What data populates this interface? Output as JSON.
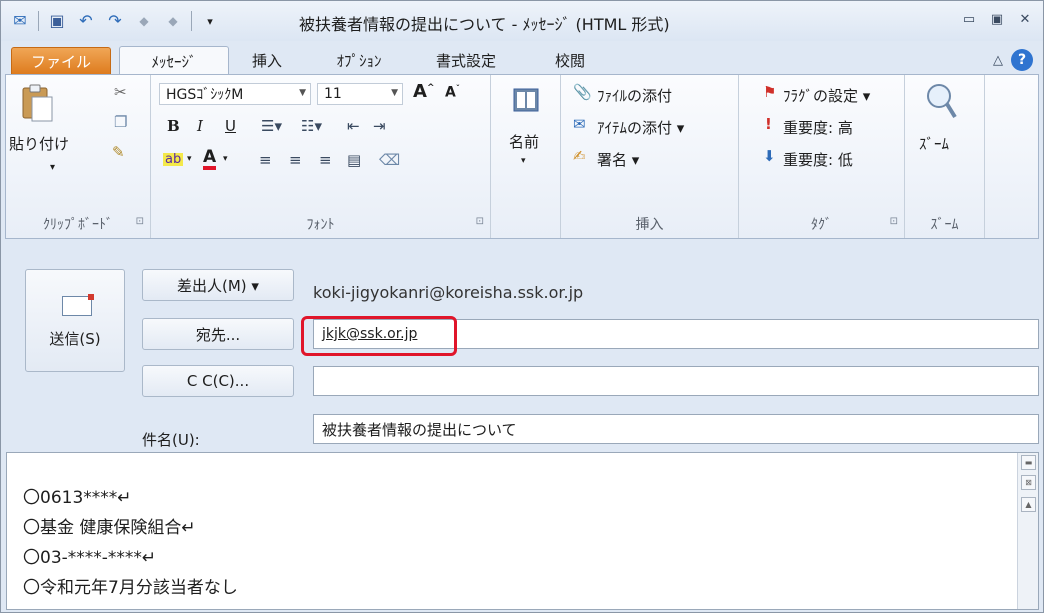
{
  "window": {
    "title": "被扶養者情報の提出について - ﾒｯｾｰｼﾞ (HTML 形式)"
  },
  "tabs": [
    {
      "label": "ファイル"
    },
    {
      "label": "ﾒｯｾｰｼﾞ"
    },
    {
      "label": "挿入"
    },
    {
      "label": "ｵﾌﾟｼｮﾝ"
    },
    {
      "label": "書式設定"
    },
    {
      "label": "校閲"
    }
  ],
  "ribbon": {
    "clipboard": {
      "paste_label": "貼り付け",
      "group_label": "ｸﾘｯﾌﾟﾎﾞｰﾄﾞ"
    },
    "font": {
      "font_name": "HGSｺﾞｼｯｸM",
      "font_size": "11",
      "group_label": "ﾌｫﾝﾄ"
    },
    "names": {
      "label": "名前"
    },
    "insert": {
      "attach_file": "ﾌｧｲﾙの添付",
      "attach_item": "ｱｲﾃﾑの添付 ▾",
      "signature": "署名 ▾",
      "group_label": "挿入"
    },
    "tags": {
      "flag": "ﾌﾗｸﾞの設定 ▾",
      "high": "重要度: 高",
      "low": "重要度: 低",
      "group_label": "ﾀｸﾞ"
    },
    "zoom": {
      "label": "ｽﾞｰﾑ",
      "group_label": "ｽﾞｰﾑ"
    }
  },
  "compose": {
    "send_label": "送信(S)",
    "from_button": "差出人(M) ▾",
    "from_value": "koki-jigyokanri@koreisha.ssk.or.jp",
    "to_button": "宛先...",
    "to_value": "jkjk@ssk.or.jp",
    "cc_button": "C C(C)...",
    "cc_value": "",
    "subject_label": "件名(U):",
    "subject_value": "被扶養者情報の提出について",
    "body_lines": [
      "〇0613****↵",
      "〇基金 健康保険組合↵",
      "〇03-****-****↵",
      "〇令和元年7月分該当者なし"
    ]
  }
}
